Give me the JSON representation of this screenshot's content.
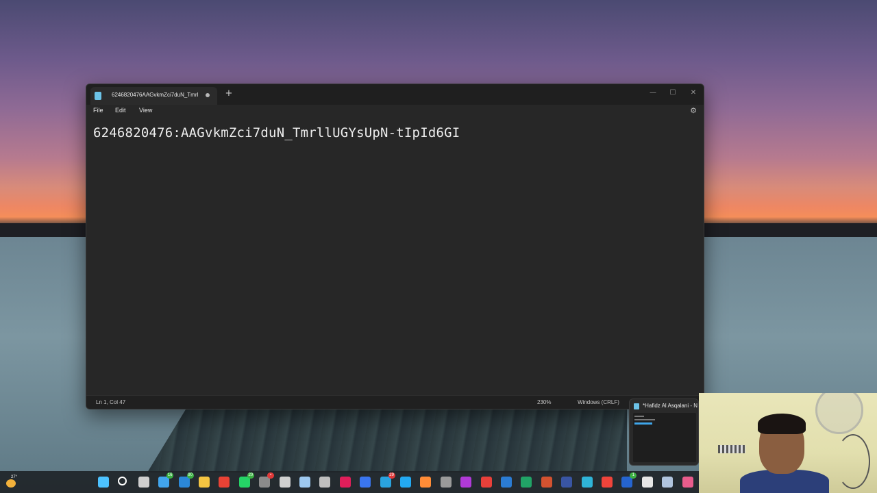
{
  "notepad": {
    "tab_title": "6246820476AAGvkmZci7duN_Tmrl",
    "new_tab_symbol": "+",
    "window_controls": {
      "minimize": "—",
      "maximize": "☐",
      "close": "✕"
    },
    "menu": [
      "File",
      "Edit",
      "View"
    ],
    "settings_icon": "⚙",
    "content": "6246820476:AAGvkmZci7duN_TmrllUGYsUpN-tIpId6GI",
    "status": {
      "position": "Ln 1, Col 47",
      "zoom": "230%",
      "line_ending": "Windows (CRLF)"
    }
  },
  "preview": {
    "title": "*Hafidz Al Asqalani - N"
  },
  "taskbar": {
    "temperature": "27°",
    "icons": [
      {
        "name": "windows-start-icon",
        "color": "#4cc2ff"
      },
      {
        "name": "search-icon",
        "color": "#ffffff"
      },
      {
        "name": "task-view-icon",
        "color": "#cfcfcf"
      },
      {
        "name": "widgets-icon",
        "color": "#41a5ee",
        "badge": "16"
      },
      {
        "name": "mail-icon",
        "color": "#2b88d8",
        "badge": "90"
      },
      {
        "name": "file-explorer-icon",
        "color": "#f4c542"
      },
      {
        "name": "chrome-icon",
        "color": "#e94235"
      },
      {
        "name": "whatsapp-icon",
        "color": "#25d366",
        "badge": "20"
      },
      {
        "name": "github-desktop-icon",
        "color": "#8b8b8b",
        "badge_red": "•"
      },
      {
        "name": "unity-icon",
        "color": "#d0d0d0"
      },
      {
        "name": "photos-icon",
        "color": "#9ec9f0"
      },
      {
        "name": "drive-icon",
        "color": "#bfbfbf"
      },
      {
        "name": "slack-icon",
        "color": "#e01e5a"
      },
      {
        "name": "signal-icon",
        "color": "#3a76f0"
      },
      {
        "name": "telegram-icon",
        "color": "#2aa3df",
        "badge_red": "29"
      },
      {
        "name": "vscode-icon",
        "color": "#23a9f2"
      },
      {
        "name": "postman-icon",
        "color": "#ff8c37"
      },
      {
        "name": "terminal-icon",
        "color": "#9a9a9a"
      },
      {
        "name": "jetbrains-icon",
        "color": "#b03ad8"
      },
      {
        "name": "wps-icon",
        "color": "#e8403a"
      },
      {
        "name": "word-icon",
        "color": "#2b7cd3"
      },
      {
        "name": "excel-icon",
        "color": "#21a366"
      },
      {
        "name": "powerpoint-icon",
        "color": "#d35230"
      },
      {
        "name": "visio-icon",
        "color": "#3955a3"
      },
      {
        "name": "edge-icon",
        "color": "#2fb4d8"
      },
      {
        "name": "anydesk-icon",
        "color": "#ef443b"
      },
      {
        "name": "todo-icon",
        "color": "#2564cf",
        "badge": "1"
      },
      {
        "name": "capcut-icon",
        "color": "#e6e6e6"
      },
      {
        "name": "virtualbox-icon",
        "color": "#b0c4de"
      },
      {
        "name": "3d-viewer-icon",
        "color": "#e85c8c"
      }
    ]
  }
}
